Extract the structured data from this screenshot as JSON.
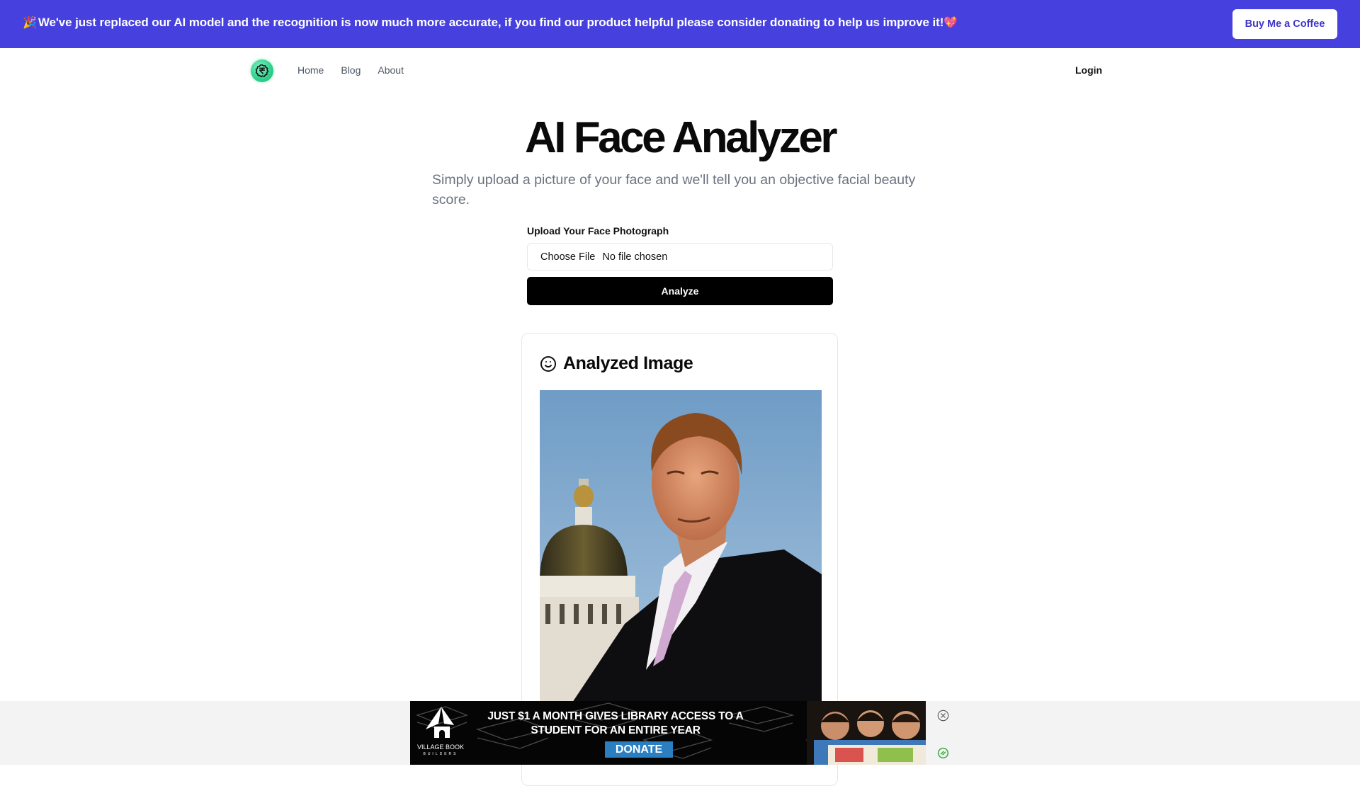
{
  "banner": {
    "emoji_left": "🎉",
    "message": "We've just replaced our AI model and the recognition is now much more accurate, if you find our product helpful please consider donating to help us improve it!",
    "emoji_right": "💖",
    "cta_label": "Buy Me a Coffee",
    "background_color": "#4640de"
  },
  "nav": {
    "logo_icon": "rupee-badge-icon",
    "links": [
      {
        "label": "Home"
      },
      {
        "label": "Blog"
      },
      {
        "label": "About"
      }
    ],
    "login_label": "Login"
  },
  "hero": {
    "title": "AI Face Analyzer",
    "subtitle": "Simply upload a picture of your face and we'll tell you an objective facial beauty score."
  },
  "upload_form": {
    "label": "Upload Your Face Photograph",
    "choose_file_label": "Choose File",
    "file_status": "No file chosen",
    "submit_label": "Analyze"
  },
  "result_card": {
    "icon": "smiley-face-icon",
    "title": "Analyzed Image",
    "image_alt": "Portrait of a man in a dark suit in front of a capitol dome"
  },
  "ad": {
    "headline": "JUST $1 A MONTH GIVES LIBRARY ACCESS TO A STUDENT FOR AN ENTIRE YEAR",
    "cta_label": "DONATE",
    "brand_name": "VILLAGE BOOK",
    "brand_sub": "BUILDERS",
    "close_icon": "close-circle-icon",
    "adchoices_icon": "adchoices-icon"
  }
}
